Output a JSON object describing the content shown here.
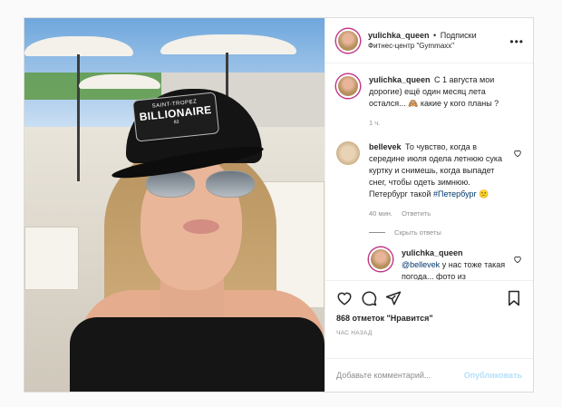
{
  "post": {
    "username": "yulichka_queen",
    "separator": "•",
    "follow_label": "Подписки",
    "location": "Фитнес-центр \"Gymmaxx\"",
    "more_label": "•••",
    "cap_text": {
      "top": "SAINT-TROPEZ",
      "main": "BILLIONAIRE",
      "num": "83"
    }
  },
  "caption": {
    "username": "yulichka_queen",
    "text": "С 1 августа мои дорогие) ещё один месяц лета остался... 🙈 какие у кого планы ?",
    "time": "1 ч."
  },
  "comment": {
    "username": "bellevek",
    "text": "То чувство, когда в середине июля одела летнюю сука куртку и снимешь, когда выпадет снег, чтобы одеть зимнюю. Петербург такой",
    "hashtag": "#Петербург",
    "emoji": "😕",
    "time": "40 мин.",
    "reply_label": "Ответить",
    "hide_replies_label": "Скрыть ответы"
  },
  "reply": {
    "username": "yulichka_queen",
    "mention": "@bellevek",
    "text": "у нас тоже такая погода... фото из"
  },
  "actions": {
    "likes": "868 отметок \"Нравится\"",
    "time": "ЧАС НАЗАД"
  },
  "add_comment": {
    "placeholder": "Добавьте комментарий...",
    "publish_label": "Опубликовать"
  },
  "colors": {
    "link": "#00376b",
    "publish_disabled": "#b2dffc",
    "muted": "#8e8e8e",
    "border": "#dbdbdb"
  }
}
